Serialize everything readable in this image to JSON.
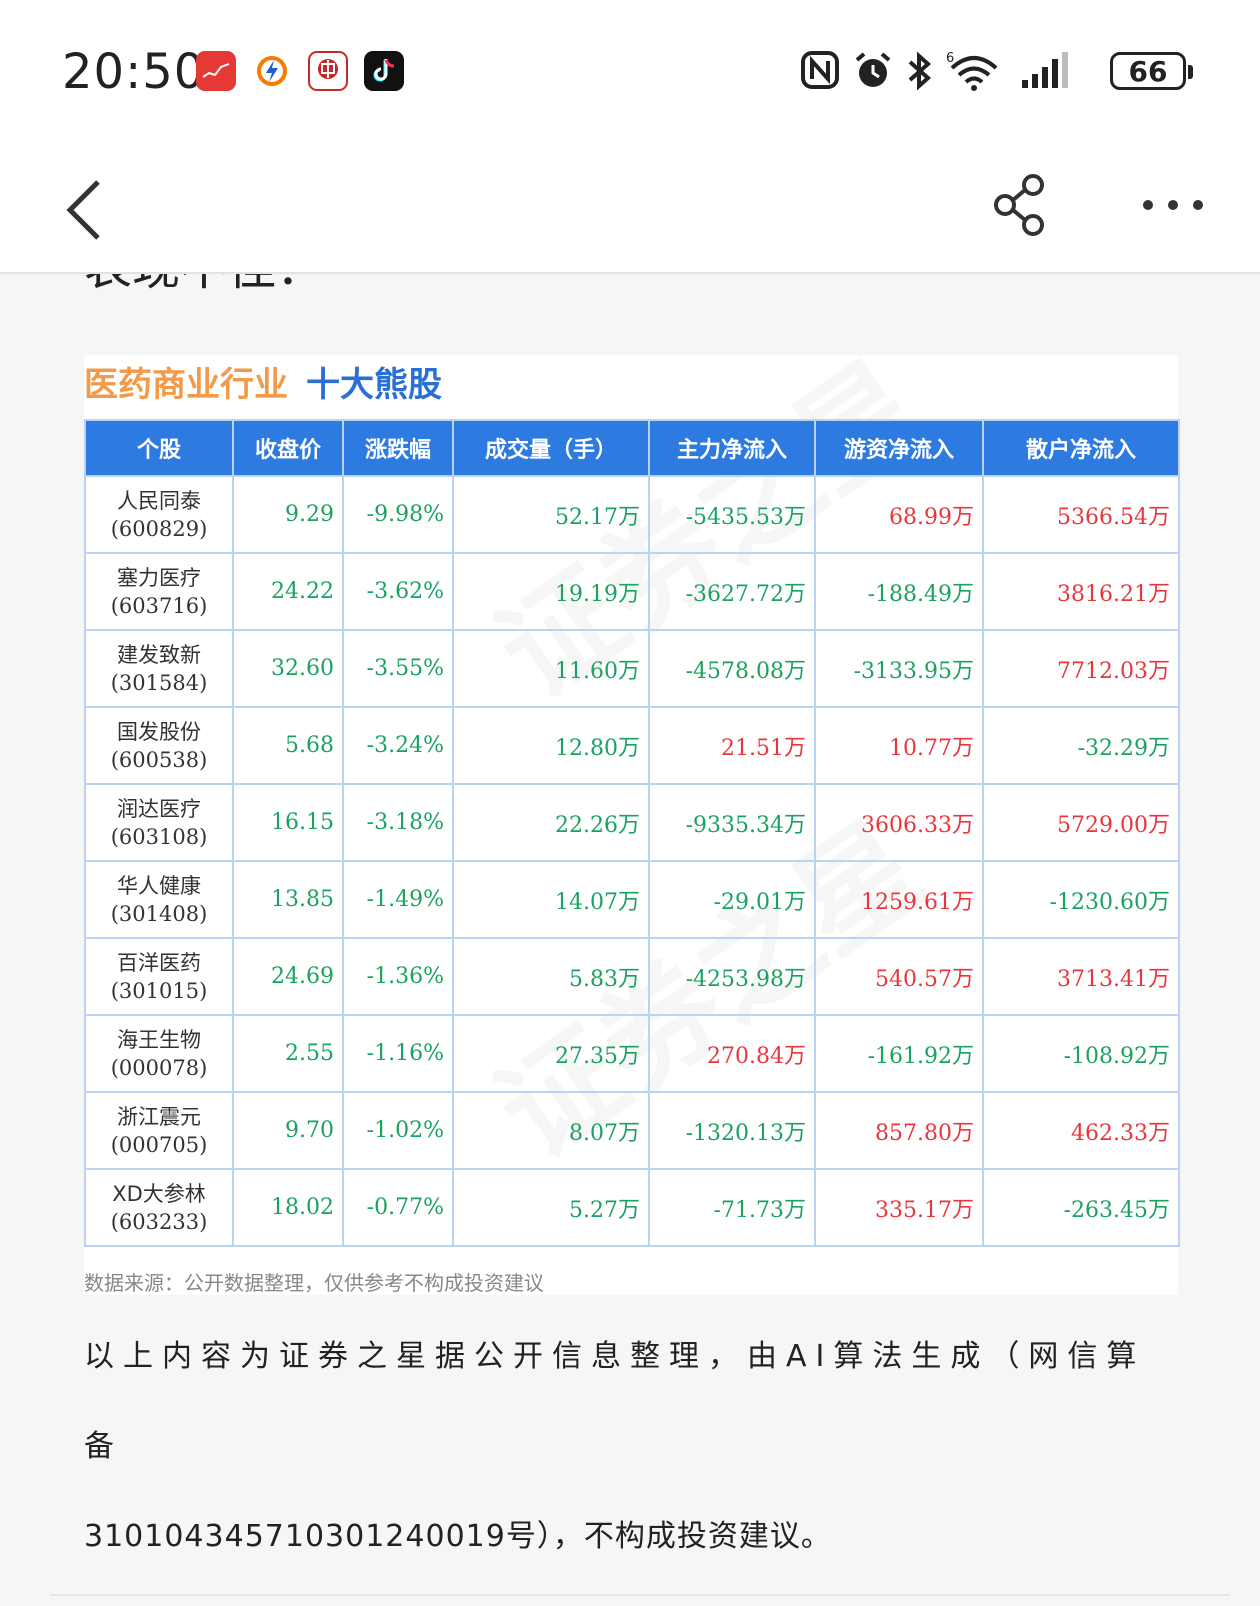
{
  "status_bar": {
    "time": "20:50",
    "battery": "66",
    "app_icons": [
      "app-red-chart-icon",
      "app-orange-bolt-icon",
      "app-zhongtai-securities-icon",
      "app-tiktok-icon"
    ],
    "system_icons": [
      "nfc-icon",
      "alarm-icon",
      "bluetooth-icon",
      "wifi-icon",
      "signal-icon",
      "battery-icon"
    ]
  },
  "nav": {
    "back_icon": "chevron-left-icon",
    "share_icon": "share-icon",
    "more_icon": "more-dots-icon"
  },
  "cut_text": "表现不佳：",
  "table_card": {
    "title_part1": "医药商业行业",
    "title_part2": "十大熊股",
    "headers": [
      "个股",
      "收盘价",
      "涨跌幅",
      "成交量（手）",
      "主力净流入",
      "游资净流入",
      "散户净流入"
    ],
    "rows": [
      {
        "name": "人民同泰",
        "code": "(600829)",
        "close": "9.29",
        "change": "-9.98%",
        "volume": "52.17万",
        "main": "-5435.53万",
        "hot": "68.99万",
        "retail": "5366.54万"
      },
      {
        "name": "塞力医疗",
        "code": "(603716)",
        "close": "24.22",
        "change": "-3.62%",
        "volume": "19.19万",
        "main": "-3627.72万",
        "hot": "-188.49万",
        "retail": "3816.21万"
      },
      {
        "name": "建发致新",
        "code": "(301584)",
        "close": "32.60",
        "change": "-3.55%",
        "volume": "11.60万",
        "main": "-4578.08万",
        "hot": "-3133.95万",
        "retail": "7712.03万"
      },
      {
        "name": "国发股份",
        "code": "(600538)",
        "close": "5.68",
        "change": "-3.24%",
        "volume": "12.80万",
        "main": "21.51万",
        "hot": "10.77万",
        "retail": "-32.29万"
      },
      {
        "name": "润达医疗",
        "code": "(603108)",
        "close": "16.15",
        "change": "-3.18%",
        "volume": "22.26万",
        "main": "-9335.34万",
        "hot": "3606.33万",
        "retail": "5729.00万"
      },
      {
        "name": "华人健康",
        "code": "(301408)",
        "close": "13.85",
        "change": "-1.49%",
        "volume": "14.07万",
        "main": "-29.01万",
        "hot": "1259.61万",
        "retail": "-1230.60万"
      },
      {
        "name": "百洋医药",
        "code": "(301015)",
        "close": "24.69",
        "change": "-1.36%",
        "volume": "5.83万",
        "main": "-4253.98万",
        "hot": "540.57万",
        "retail": "3713.41万"
      },
      {
        "name": "海王生物",
        "code": "(000078)",
        "close": "2.55",
        "change": "-1.16%",
        "volume": "27.35万",
        "main": "270.84万",
        "hot": "-161.92万",
        "retail": "-108.92万"
      },
      {
        "name": "浙江震元",
        "code": "(000705)",
        "close": "9.70",
        "change": "-1.02%",
        "volume": "8.07万",
        "main": "-1320.13万",
        "hot": "857.80万",
        "retail": "462.33万"
      },
      {
        "name": "XD大参林",
        "code": "(603233)",
        "close": "18.02",
        "change": "-0.77%",
        "volume": "5.27万",
        "main": "-71.73万",
        "hot": "335.17万",
        "retail": "-263.45万"
      }
    ],
    "source": "数据来源：公开数据整理，仅供参考不构成投资建议",
    "watermark": "证券之星"
  },
  "paragraph": {
    "line1": "以上内容为证券之星据公开信息整理，由AI算法生成（网信算备",
    "line2": "310104345710301240019号），不构成投资建议。"
  },
  "colors": {
    "header_blue": "#2d7be0",
    "title_orange": "#f29a4a",
    "title_blue": "#2a6fd6",
    "up_red": "#e8363c",
    "down_green": "#1aa260"
  }
}
